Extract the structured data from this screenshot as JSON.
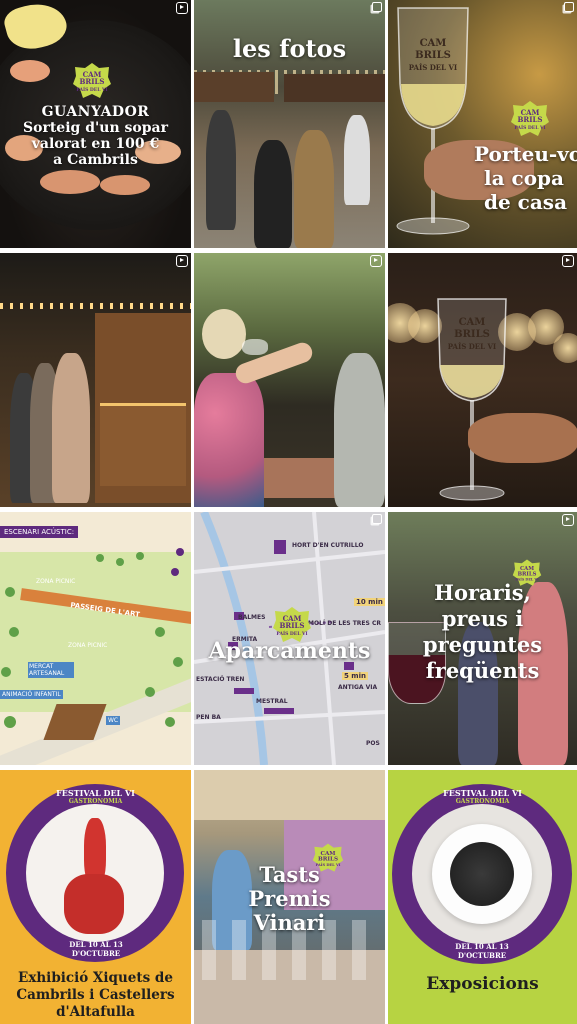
{
  "colors": {
    "purple": "#5e2a7e",
    "lime": "#c5d94a",
    "orange_bg": "#f2b233",
    "green_bg": "#b7d342",
    "map_bg": "#f3ead5",
    "map_gray": "#c9c8cc"
  },
  "badge": {
    "line1": "CAM",
    "line2": "BRILS",
    "line3": "PAÍS DEL VI"
  },
  "tiles": {
    "t1": {
      "line1": "GUANYADOR",
      "line2": "Sorteig d'un sopar",
      "line3": "valorat en 100 €",
      "line4": "a Cambrils",
      "icon": "reel-icon"
    },
    "t2": {
      "title": "les fotos",
      "icon": "multi-icon"
    },
    "t3": {
      "line1": "Porteu-vo",
      "line2": "la copa",
      "line3": "de casa",
      "icon": "multi-icon"
    },
    "t4": {
      "icon": "reel-icon"
    },
    "t5": {
      "icon": "reel-icon"
    },
    "t6": {
      "icon": "reel-icon",
      "glass_text1": "CAM",
      "glass_text2": "BRILS",
      "glass_text3": "PAÍS DEL VI"
    },
    "t7": {
      "labels": [
        "ESCENARI ACÚSTIC:",
        "ZONA PICNIC",
        "PASSEIG DE L'ART",
        "ZONA PICNIC",
        "MERCAT ARTESANAL",
        "ANIMACIÓ INFANTIL",
        "WC"
      ]
    },
    "t8": {
      "title": "Aparcaments",
      "icon": "multi-icon",
      "labels": [
        "HORT D'EN CUTRILLO",
        "BALMES",
        "MOLÍ DE LES TRES CR",
        "ERMITA",
        "ESTACIÓ TREN",
        "ANTIGA VIA",
        "MESTRAL",
        "PEN BA",
        "POS"
      ],
      "walk1": "10 min",
      "walk2": "5 min"
    },
    "t9": {
      "line1": "Horaris,",
      "line2": "preus i",
      "line3": "preguntes",
      "line4": "freqüents",
      "icon": "reel-icon"
    },
    "t10": {
      "ring_top": "FESTIVAL DEL VI",
      "ring_sub": "GASTRONOMIA",
      "dates": "DEL 10 AL 13 D'OCTUBRE",
      "line1": "Exhibició Xiquets de",
      "line2": "Cambrils i Castellers",
      "line3": "d'Altafulla"
    },
    "t11": {
      "line1": "Tasts",
      "line2": "Premis",
      "line3": "Vinari"
    },
    "t12": {
      "ring_top": "FESTIVAL DEL VI",
      "ring_sub": "GASTRONOMIA",
      "dates": "DEL 10 AL 13 D'OCTUBRE",
      "title": "Exposicions"
    }
  }
}
